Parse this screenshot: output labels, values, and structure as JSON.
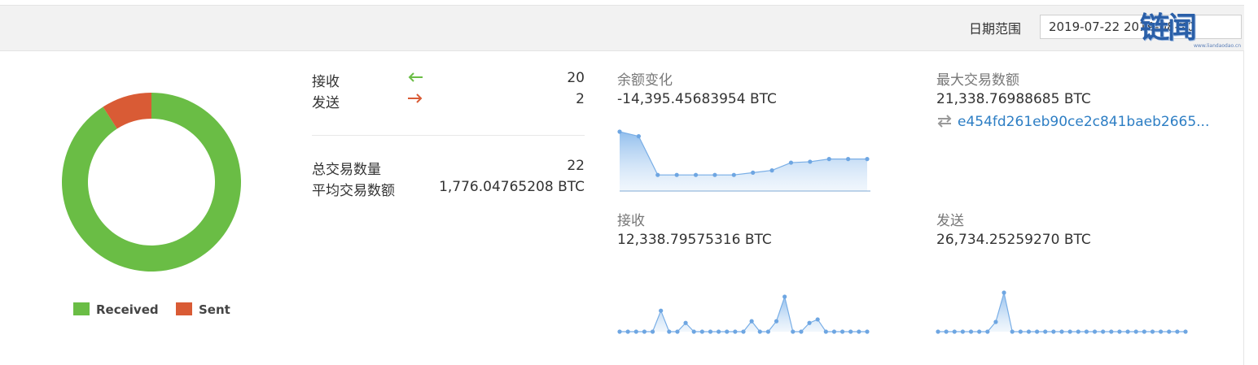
{
  "header": {
    "date_label": "日期范围",
    "date_value": "2019-07-22  2019-08-20",
    "watermark": "链闻",
    "watermark_sub": "www.liandaodao.cn"
  },
  "donut": {
    "received_fraction": 0.909,
    "sent_fraction": 0.091,
    "colors": {
      "received": "#6abd45",
      "sent": "#d95b35"
    },
    "legend": {
      "received": "Received",
      "sent": "Sent"
    }
  },
  "stats": {
    "received_label": "接收",
    "received_count": "20",
    "sent_label": "发送",
    "sent_count": "2",
    "total_label": "总交易数量",
    "total_value": "22",
    "avg_label": "平均交易数额",
    "avg_value": "1,776.04765208 BTC"
  },
  "metrics": {
    "balance_change": {
      "title": "余额变化",
      "value": "-14,395.45683954 BTC"
    },
    "largest_tx": {
      "title": "最大交易数额",
      "value": "21,338.76988685 BTC",
      "tx_hash": "e454fd261eb90ce2c841baeb2665..."
    },
    "received": {
      "title": "接收",
      "value": "12,338.79575316 BTC"
    },
    "sent": {
      "title": "发送",
      "value": "26,734.25259270 BTC"
    }
  },
  "chart_data": [
    {
      "type": "area",
      "name": "balance",
      "values": [
        1.0,
        0.9,
        0.05,
        0.05,
        0.05,
        0.05,
        0.05,
        0.1,
        0.15,
        0.32,
        0.34,
        0.4,
        0.4,
        0.4
      ]
    },
    {
      "type": "area",
      "name": "received",
      "values": [
        0,
        0,
        0,
        0,
        0,
        0.6,
        0,
        0,
        0.25,
        0,
        0,
        0,
        0,
        0,
        0,
        0,
        0.3,
        0,
        0,
        0.3,
        1.0,
        0,
        0,
        0.25,
        0.35,
        0,
        0,
        0,
        0,
        0,
        0
      ]
    },
    {
      "type": "area",
      "name": "sent",
      "values": [
        0,
        0,
        0,
        0,
        0,
        0,
        0,
        0.25,
        1.0,
        0,
        0,
        0,
        0,
        0,
        0,
        0,
        0,
        0,
        0,
        0,
        0,
        0,
        0,
        0,
        0,
        0,
        0,
        0,
        0,
        0,
        0
      ]
    }
  ]
}
